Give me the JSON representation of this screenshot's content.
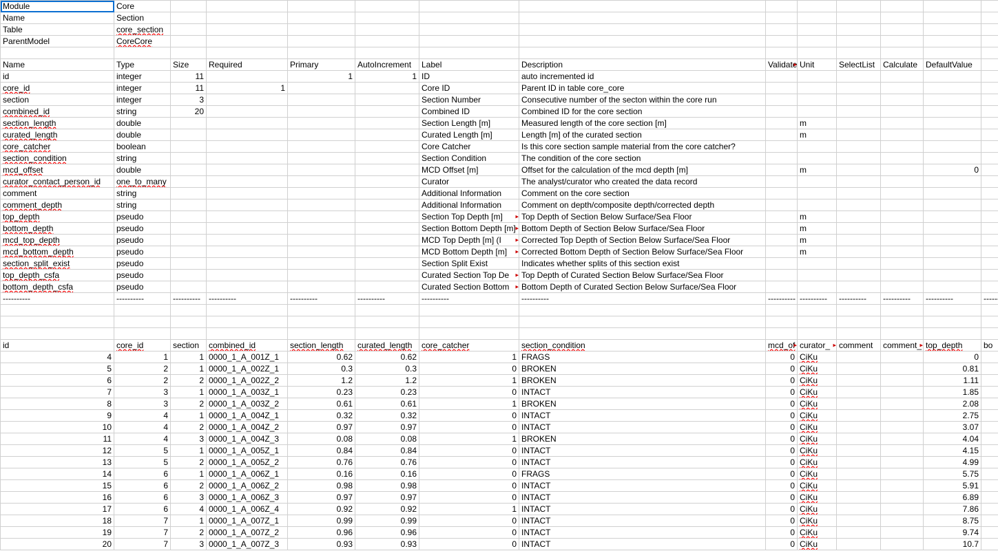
{
  "meta_rows": [
    {
      "k": "Module",
      "v": "Core"
    },
    {
      "k": "Name",
      "v": "Section"
    },
    {
      "k": "Table",
      "v": "core_section"
    },
    {
      "k": "ParentModel",
      "v": "CoreCore"
    }
  ],
  "schema_header": {
    "name": "Name",
    "type": "Type",
    "size": "Size",
    "required": "Required",
    "primary": "Primary",
    "autoinc": "AutoIncrement",
    "label": "Label",
    "description": "Description",
    "validate": "Validate",
    "unit": "Unit",
    "selectlist": "SelectList",
    "calculate": "Calculate",
    "defaultvalue": "DefaultValue"
  },
  "schema_rows": [
    {
      "name": "id",
      "type": "integer",
      "size": "11",
      "required": "",
      "primary": "1",
      "autoinc": "1",
      "label": "ID",
      "description": "auto incremented id",
      "validate": "",
      "unit": "",
      "selectlist": "",
      "calculate": "",
      "defaultvalue": "",
      "spell": false,
      "ovf": false
    },
    {
      "name": "core_id",
      "type": "integer",
      "size": "11",
      "required": "1",
      "primary": "",
      "autoinc": "",
      "label": "Core ID",
      "description": "Parent ID in table core_core",
      "validate": "",
      "unit": "",
      "selectlist": "",
      "calculate": "",
      "defaultvalue": "",
      "spell": true,
      "ovf": false
    },
    {
      "name": "section",
      "type": "integer",
      "size": "3",
      "required": "",
      "primary": "",
      "autoinc": "",
      "label": "Section Number",
      "description": "Consecutive number of the secton within the core run",
      "validate": "",
      "unit": "",
      "selectlist": "",
      "calculate": "",
      "defaultvalue": "",
      "spell": false,
      "ovf": false
    },
    {
      "name": "combined_id",
      "type": "string",
      "size": "20",
      "required": "",
      "primary": "",
      "autoinc": "",
      "label": "Combined ID",
      "description": "Combined ID for the core section",
      "validate": "",
      "unit": "",
      "selectlist": "",
      "calculate": "",
      "defaultvalue": "",
      "spell": true,
      "ovf": false
    },
    {
      "name": "section_length",
      "type": "double",
      "size": "",
      "required": "",
      "primary": "",
      "autoinc": "",
      "label": "Section Length [m]",
      "description": "Measured length of the core section [m]",
      "validate": "",
      "unit": "m",
      "selectlist": "",
      "calculate": "",
      "defaultvalue": "",
      "spell": true,
      "ovf": false
    },
    {
      "name": "curated_length",
      "type": "double",
      "size": "",
      "required": "",
      "primary": "",
      "autoinc": "",
      "label": "Curated Length [m]",
      "description": "Length [m] of the curated section",
      "validate": "",
      "unit": "m",
      "selectlist": "",
      "calculate": "",
      "defaultvalue": "",
      "spell": true,
      "ovf": false
    },
    {
      "name": "core_catcher",
      "type": "boolean",
      "size": "",
      "required": "",
      "primary": "",
      "autoinc": "",
      "label": "Core Catcher",
      "description": "Is this core section sample material from the core catcher?",
      "validate": "",
      "unit": "",
      "selectlist": "",
      "calculate": "",
      "defaultvalue": "",
      "spell": true,
      "ovf": false
    },
    {
      "name": "section_condition",
      "type": "string",
      "size": "",
      "required": "",
      "primary": "",
      "autoinc": "",
      "label": "Section Condition",
      "description": "The condition of the core section",
      "validate": "",
      "unit": "",
      "selectlist": "",
      "calculate": "",
      "defaultvalue": "",
      "spell": true,
      "ovf": false
    },
    {
      "name": "mcd_offset",
      "type": "double",
      "size": "",
      "required": "",
      "primary": "",
      "autoinc": "",
      "label": "MCD Offset [m]",
      "description": "Offset for the calculation of the mcd depth [m]",
      "validate": "",
      "unit": "m",
      "selectlist": "",
      "calculate": "",
      "defaultvalue": "0",
      "spell": true,
      "ovf": false
    },
    {
      "name": "curator_contact_person_id",
      "type": "one_to_many",
      "size": "",
      "required": "",
      "primary": "",
      "autoinc": "",
      "label": "Curator",
      "description": "The analyst/curator who created the data record",
      "validate": "",
      "unit": "",
      "selectlist": "",
      "calculate": "",
      "defaultvalue": "",
      "spell": true,
      "ovf": false
    },
    {
      "name": "comment",
      "type": "string",
      "size": "",
      "required": "",
      "primary": "",
      "autoinc": "",
      "label": "Additional Information",
      "description": "Comment on the core section",
      "validate": "",
      "unit": "",
      "selectlist": "",
      "calculate": "",
      "defaultvalue": "",
      "spell": false,
      "ovf": false
    },
    {
      "name": "comment_depth",
      "type": "string",
      "size": "",
      "required": "",
      "primary": "",
      "autoinc": "",
      "label": "Additional Information",
      "description": "Comment on depth/composite depth/corrected depth",
      "validate": "",
      "unit": "",
      "selectlist": "",
      "calculate": "",
      "defaultvalue": "",
      "spell": true,
      "ovf": false
    },
    {
      "name": "top_depth",
      "type": "pseudo",
      "size": "",
      "required": "",
      "primary": "",
      "autoinc": "",
      "label": "Section Top Depth [m]",
      "description": "Top Depth of Section Below Surface/Sea Floor",
      "validate": "",
      "unit": "m",
      "selectlist": "",
      "calculate": "",
      "defaultvalue": "",
      "spell": true,
      "ovf": true
    },
    {
      "name": "bottom_depth",
      "type": "pseudo",
      "size": "",
      "required": "",
      "primary": "",
      "autoinc": "",
      "label": "Section Bottom Depth [m]",
      "description": "Bottom Depth of Section Below Surface/Sea Floor",
      "validate": "",
      "unit": "m",
      "selectlist": "",
      "calculate": "",
      "defaultvalue": "",
      "spell": true,
      "ovf": true
    },
    {
      "name": "mcd_top_depth",
      "type": "pseudo",
      "size": "",
      "required": "",
      "primary": "",
      "autoinc": "",
      "label": "MCD Top Depth [m]   (I",
      "description": "Corrected Top Depth of Section Below Surface/Sea Floor",
      "validate": "",
      "unit": "m",
      "selectlist": "",
      "calculate": "",
      "defaultvalue": "",
      "spell": true,
      "ovf": true
    },
    {
      "name": "mcd_bottom_depth",
      "type": "pseudo",
      "size": "",
      "required": "",
      "primary": "",
      "autoinc": "",
      "label": "MCD Bottom Depth [m]",
      "description": "Corrected Bottom Depth of Section Below Surface/Sea Floor",
      "validate": "",
      "unit": "m",
      "selectlist": "",
      "calculate": "",
      "defaultvalue": "",
      "spell": true,
      "ovf": true
    },
    {
      "name": "section_split_exist",
      "type": "pseudo",
      "size": "",
      "required": "",
      "primary": "",
      "autoinc": "",
      "label": "Section Split Exist",
      "description": "Indicates whether splits of this section exist",
      "validate": "",
      "unit": "",
      "selectlist": "",
      "calculate": "",
      "defaultvalue": "",
      "spell": true,
      "ovf": false
    },
    {
      "name": "top_depth_csfa",
      "type": "pseudo",
      "size": "",
      "required": "",
      "primary": "",
      "autoinc": "",
      "label": "Curated Section Top De",
      "description": "Top Depth of Curated Section Below Surface/Sea Floor",
      "validate": "",
      "unit": "",
      "selectlist": "",
      "calculate": "",
      "defaultvalue": "",
      "spell": true,
      "ovf": true
    },
    {
      "name": "bottom_depth_csfa",
      "type": "pseudo",
      "size": "",
      "required": "",
      "primary": "",
      "autoinc": "",
      "label": "Curated Section Bottom",
      "description": "Bottom Depth of Curated Section Below Surface/Sea Floor",
      "validate": "",
      "unit": "",
      "selectlist": "",
      "calculate": "",
      "defaultvalue": "",
      "spell": true,
      "ovf": true
    }
  ],
  "sep": "----------",
  "data_header": {
    "id": "id",
    "core_id": "core_id",
    "section": "section",
    "combined_id": "combined_id",
    "section_length": "section_length",
    "curated_length": "curated_length",
    "core_catcher": "core_catcher",
    "section_condition": "section_condition",
    "mcd_offset": "mcd_of",
    "curator": "curator_",
    "comment": "comment",
    "comment_depth": "comment_",
    "top_depth": "top_depth",
    "bottom": "bo"
  },
  "data_rows": [
    {
      "id": "4",
      "core_id": "1",
      "section": "1",
      "combined_id": "0000_1_A_001Z_1",
      "section_length": "0.62",
      "curated_length": "0.62",
      "core_catcher": "1",
      "section_condition": "FRAGS",
      "mcd_offset": "0",
      "curator": "CiKu",
      "comment": "",
      "comment_depth": "",
      "top_depth": "0"
    },
    {
      "id": "5",
      "core_id": "2",
      "section": "1",
      "combined_id": "0000_1_A_002Z_1",
      "section_length": "0.3",
      "curated_length": "0.3",
      "core_catcher": "0",
      "section_condition": "BROKEN",
      "mcd_offset": "0",
      "curator": "CiKu",
      "comment": "",
      "comment_depth": "",
      "top_depth": "0.81"
    },
    {
      "id": "6",
      "core_id": "2",
      "section": "2",
      "combined_id": "0000_1_A_002Z_2",
      "section_length": "1.2",
      "curated_length": "1.2",
      "core_catcher": "1",
      "section_condition": "BROKEN",
      "mcd_offset": "0",
      "curator": "CiKu",
      "comment": "",
      "comment_depth": "",
      "top_depth": "1.11"
    },
    {
      "id": "7",
      "core_id": "3",
      "section": "1",
      "combined_id": "0000_1_A_003Z_1",
      "section_length": "0.23",
      "curated_length": "0.23",
      "core_catcher": "0",
      "section_condition": "INTACT",
      "mcd_offset": "0",
      "curator": "CiKu",
      "comment": "",
      "comment_depth": "",
      "top_depth": "1.85"
    },
    {
      "id": "8",
      "core_id": "3",
      "section": "2",
      "combined_id": "0000_1_A_003Z_2",
      "section_length": "0.61",
      "curated_length": "0.61",
      "core_catcher": "1",
      "section_condition": "BROKEN",
      "mcd_offset": "0",
      "curator": "CiKu",
      "comment": "",
      "comment_depth": "",
      "top_depth": "2.08"
    },
    {
      "id": "9",
      "core_id": "4",
      "section": "1",
      "combined_id": "0000_1_A_004Z_1",
      "section_length": "0.32",
      "curated_length": "0.32",
      "core_catcher": "0",
      "section_condition": "INTACT",
      "mcd_offset": "0",
      "curator": "CiKu",
      "comment": "",
      "comment_depth": "",
      "top_depth": "2.75"
    },
    {
      "id": "10",
      "core_id": "4",
      "section": "2",
      "combined_id": "0000_1_A_004Z_2",
      "section_length": "0.97",
      "curated_length": "0.97",
      "core_catcher": "0",
      "section_condition": "INTACT",
      "mcd_offset": "0",
      "curator": "CiKu",
      "comment": "",
      "comment_depth": "",
      "top_depth": "3.07"
    },
    {
      "id": "11",
      "core_id": "4",
      "section": "3",
      "combined_id": "0000_1_A_004Z_3",
      "section_length": "0.08",
      "curated_length": "0.08",
      "core_catcher": "1",
      "section_condition": "BROKEN",
      "mcd_offset": "0",
      "curator": "CiKu",
      "comment": "",
      "comment_depth": "",
      "top_depth": "4.04"
    },
    {
      "id": "12",
      "core_id": "5",
      "section": "1",
      "combined_id": "0000_1_A_005Z_1",
      "section_length": "0.84",
      "curated_length": "0.84",
      "core_catcher": "0",
      "section_condition": "INTACT",
      "mcd_offset": "0",
      "curator": "CiKu",
      "comment": "",
      "comment_depth": "",
      "top_depth": "4.15"
    },
    {
      "id": "13",
      "core_id": "5",
      "section": "2",
      "combined_id": "0000_1_A_005Z_2",
      "section_length": "0.76",
      "curated_length": "0.76",
      "core_catcher": "0",
      "section_condition": "INTACT",
      "mcd_offset": "0",
      "curator": "CiKu",
      "comment": "",
      "comment_depth": "",
      "top_depth": "4.99"
    },
    {
      "id": "14",
      "core_id": "6",
      "section": "1",
      "combined_id": "0000_1_A_006Z_1",
      "section_length": "0.16",
      "curated_length": "0.16",
      "core_catcher": "0",
      "section_condition": "FRAGS",
      "mcd_offset": "0",
      "curator": "CiKu",
      "comment": "",
      "comment_depth": "",
      "top_depth": "5.75"
    },
    {
      "id": "15",
      "core_id": "6",
      "section": "2",
      "combined_id": "0000_1_A_006Z_2",
      "section_length": "0.98",
      "curated_length": "0.98",
      "core_catcher": "0",
      "section_condition": "INTACT",
      "mcd_offset": "0",
      "curator": "CiKu",
      "comment": "",
      "comment_depth": "",
      "top_depth": "5.91"
    },
    {
      "id": "16",
      "core_id": "6",
      "section": "3",
      "combined_id": "0000_1_A_006Z_3",
      "section_length": "0.97",
      "curated_length": "0.97",
      "core_catcher": "0",
      "section_condition": "INTACT",
      "mcd_offset": "0",
      "curator": "CiKu",
      "comment": "",
      "comment_depth": "",
      "top_depth": "6.89"
    },
    {
      "id": "17",
      "core_id": "6",
      "section": "4",
      "combined_id": "0000_1_A_006Z_4",
      "section_length": "0.92",
      "curated_length": "0.92",
      "core_catcher": "1",
      "section_condition": "INTACT",
      "mcd_offset": "0",
      "curator": "CiKu",
      "comment": "",
      "comment_depth": "",
      "top_depth": "7.86"
    },
    {
      "id": "18",
      "core_id": "7",
      "section": "1",
      "combined_id": "0000_1_A_007Z_1",
      "section_length": "0.99",
      "curated_length": "0.99",
      "core_catcher": "0",
      "section_condition": "INTACT",
      "mcd_offset": "0",
      "curator": "CiKu",
      "comment": "",
      "comment_depth": "",
      "top_depth": "8.75"
    },
    {
      "id": "19",
      "core_id": "7",
      "section": "2",
      "combined_id": "0000_1_A_007Z_2",
      "section_length": "0.96",
      "curated_length": "0.96",
      "core_catcher": "0",
      "section_condition": "INTACT",
      "mcd_offset": "0",
      "curator": "CiKu",
      "comment": "",
      "comment_depth": "",
      "top_depth": "9.74"
    },
    {
      "id": "20",
      "core_id": "7",
      "section": "3",
      "combined_id": "0000_1_A_007Z_3",
      "section_length": "0.93",
      "curated_length": "0.93",
      "core_catcher": "0",
      "section_condition": "INTACT",
      "mcd_offset": "0",
      "curator": "CiKu",
      "comment": "",
      "comment_depth": "",
      "top_depth": "10.7"
    }
  ]
}
